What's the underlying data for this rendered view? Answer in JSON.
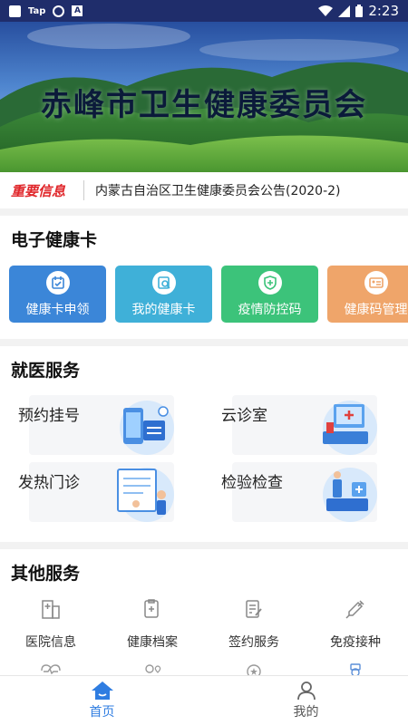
{
  "status_bar": {
    "app_label": "Tap",
    "a_label": "A",
    "time": "2:23"
  },
  "banner": {
    "title": "赤峰市卫生健康委员会"
  },
  "notice": {
    "tag": "重要信息",
    "text": "内蒙古自治区卫生健康委员会公告(2020-2)"
  },
  "health_card": {
    "title": "电子健康卡",
    "cards": [
      {
        "label": "健康卡申领",
        "icon": "card-apply-icon",
        "color": "#3b86d8"
      },
      {
        "label": "我的健康卡",
        "icon": "my-card-icon",
        "color": "#3fb0d8"
      },
      {
        "label": "疫情防控码",
        "icon": "shield-plus-icon",
        "color": "#3cc37a"
      },
      {
        "label": "健康码管理",
        "icon": "id-card-icon",
        "color": "#efa56a"
      }
    ]
  },
  "medical": {
    "title": "就医服务",
    "items": [
      {
        "label": "预约挂号",
        "icon": "phone-calendar-illustration"
      },
      {
        "label": "云诊室",
        "icon": "cloud-clinic-illustration"
      },
      {
        "label": "发热门诊",
        "icon": "fever-clinic-illustration"
      },
      {
        "label": "检验检查",
        "icon": "lab-test-illustration"
      }
    ]
  },
  "other": {
    "title": "其他服务",
    "items": [
      {
        "label": "医院信息",
        "icon": "hospital-icon"
      },
      {
        "label": "健康档案",
        "icon": "health-record-icon"
      },
      {
        "label": "签约服务",
        "icon": "contract-icon"
      },
      {
        "label": "免疫接种",
        "icon": "syringe-icon"
      }
    ]
  },
  "nav": {
    "home": "首页",
    "mine": "我的"
  },
  "colors": {
    "accent": "#2f7de1",
    "notice_red": "#e0262a"
  }
}
